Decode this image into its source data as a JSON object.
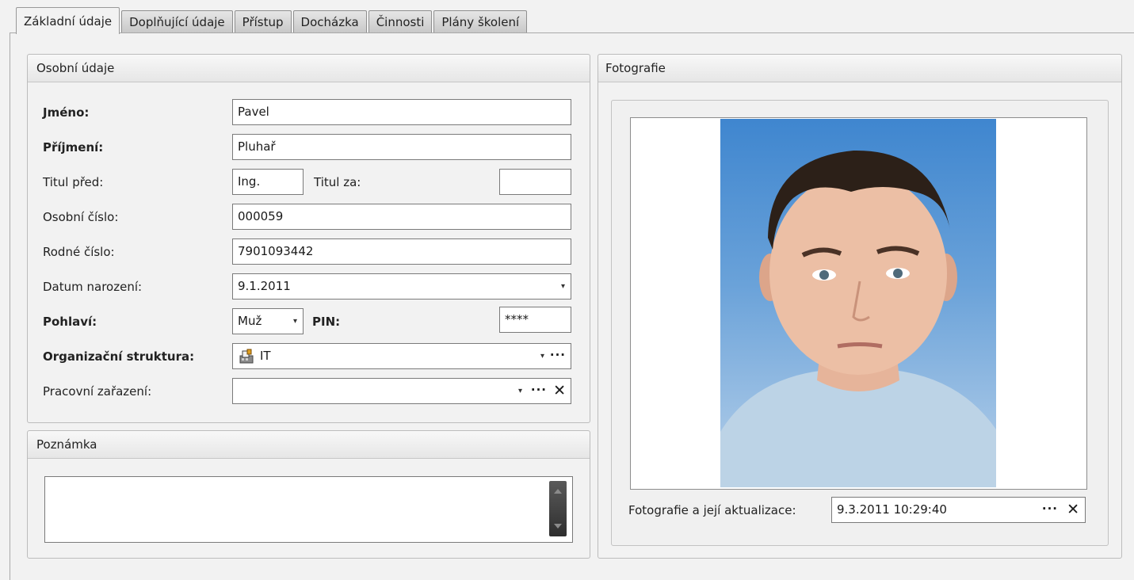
{
  "tabs": [
    "Základní údaje",
    "Doplňující údaje",
    "Přístup",
    "Docházka",
    "Činnosti",
    "Plány školení"
  ],
  "personal": {
    "title": "Osobní údaje",
    "labels": {
      "first_name": "Jméno:",
      "last_name": "Příjmení:",
      "title_before": "Titul před:",
      "title_after": "Titul za:",
      "personal_number": "Osobní číslo:",
      "birth_number": "Rodné číslo:",
      "birth_date": "Datum narození:",
      "gender": "Pohlaví:",
      "pin": "PIN:",
      "org_structure": "Organizační struktura:",
      "job_position": "Pracovní zařazení:"
    },
    "values": {
      "first_name": "Pavel",
      "last_name": "Pluhař",
      "title_before": "Ing.",
      "title_after": "",
      "personal_number": "000059",
      "birth_number": "7901093442",
      "birth_date": "9.1.2011",
      "gender": "Muž",
      "pin": "****",
      "org_structure": "IT",
      "job_position": ""
    }
  },
  "note": {
    "title": "Poznámka",
    "value": ""
  },
  "photo": {
    "title": "Fotografie",
    "update_label": "Fotografie a její aktualizace:",
    "update_value": "9.3.2011 10:29:40"
  },
  "glyphs": {
    "dropdown": "▾",
    "dots": "···",
    "clear": "✕"
  },
  "icons": {
    "org": "building-icon"
  }
}
